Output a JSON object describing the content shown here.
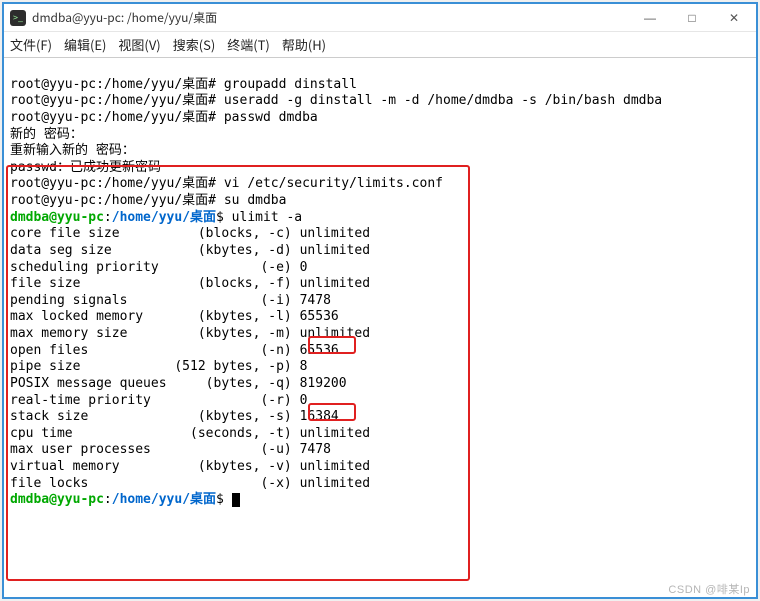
{
  "window": {
    "title": "dmdba@yyu-pc: /home/yyu/桌面",
    "min_label": "—",
    "max_label": "□",
    "close_label": "✕"
  },
  "menu": {
    "file": "文件(F)",
    "edit": "编辑(E)",
    "view": "视图(V)",
    "search": "搜索(S)",
    "terminal": "终端(T)",
    "help": "帮助(H)"
  },
  "lines": {
    "l1": "root@yyu-pc:/home/yyu/桌面# groupadd dinstall",
    "l2": "root@yyu-pc:/home/yyu/桌面# useradd -g dinstall -m -d /home/dmdba -s /bin/bash dmdba",
    "l3": "root@yyu-pc:/home/yyu/桌面# passwd dmdba",
    "l4": "新的 密码：",
    "l5": "重新输入新的 密码：",
    "l6": "passwd：已成功更新密码",
    "l7": "root@yyu-pc:/home/yyu/桌面# vi /etc/security/limits.conf",
    "l8": "root@yyu-pc:/home/yyu/桌面# su dmdba",
    "p_user1": "dmdba@yyu-pc",
    "p_path1": "/home/yyu/桌面",
    "p_cmd1": "$ ulimit -a",
    "u01": "core file size          (blocks, -c) unlimited",
    "u02": "data seg size           (kbytes, -d) unlimited",
    "u03": "scheduling priority             (-e) 0",
    "u04": "file size               (blocks, -f) unlimited",
    "u05": "pending signals                 (-i) 7478",
    "u06": "max locked memory       (kbytes, -l) 65536",
    "u07": "max memory size         (kbytes, -m) unlimited",
    "u08": "open files                      (-n) 65536",
    "u09": "pipe size            (512 bytes, -p) 8",
    "u10": "POSIX message queues     (bytes, -q) 819200",
    "u11": "real-time priority              (-r) 0",
    "u12": "stack size              (kbytes, -s) 16384",
    "u13": "cpu time               (seconds, -t) unlimited",
    "u14": "max user processes              (-u) 7478",
    "u15": "virtual memory          (kbytes, -v) unlimited",
    "u16": "file locks                      (-x) unlimited",
    "p_user2": "dmdba@yyu-pc",
    "p_path2": "/home/yyu/桌面",
    "p_cmd2": "$ "
  },
  "watermark": "CSDN @啡某Ip"
}
